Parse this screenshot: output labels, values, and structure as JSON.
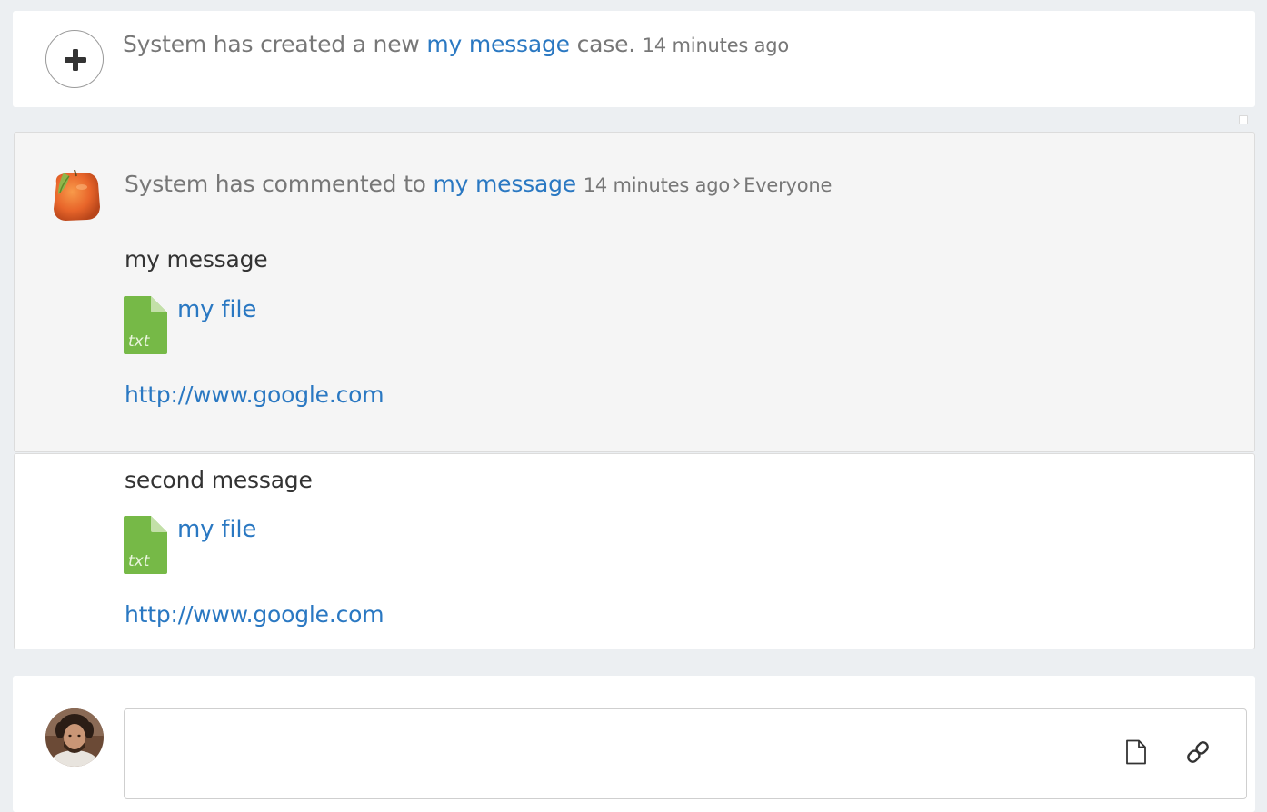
{
  "created": {
    "prefix": "System has created a new ",
    "link": "my message",
    "suffix": " case. ",
    "time": "14 minutes ago",
    "icon": "plus-circle-icon"
  },
  "comment": {
    "author_prefix": "System has commented to ",
    "link": "my message",
    "time": "14 minutes ago",
    "audience": "Everyone",
    "avatar_icon": "orange-avatar",
    "messages": [
      {
        "text": "my message",
        "file_ext": "txt",
        "file_name": "my file",
        "url": "http://www.google.com"
      },
      {
        "text": "second message",
        "file_ext": "txt",
        "file_name": "my file",
        "url": "http://www.google.com"
      }
    ]
  },
  "composer": {
    "placeholder": "",
    "value": "",
    "attach_icon": "file-icon",
    "link_icon": "link-icon"
  },
  "colors": {
    "link": "#2a78c2",
    "file_green": "#76b947",
    "background": "#eceff2"
  }
}
